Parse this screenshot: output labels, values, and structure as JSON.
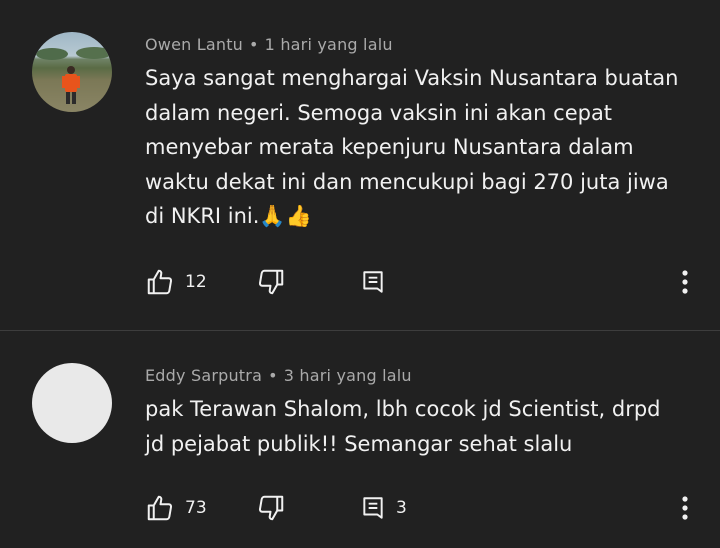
{
  "comments": [
    {
      "author": "Owen Lantu",
      "separator": "•",
      "time": "1 hari yang lalu",
      "text": "Saya sangat menghargai Vaksin Nusantara buatan\ndalam negeri. Semoga vaksin ini akan cepat\nmenyebar merata kepenjuru Nusantara dalam\nwaktu dekat ini dan mencukupi bagi 270 juta jiwa\ndi NKRI ini.🙏👍",
      "likes": "12",
      "replies": ""
    },
    {
      "author": "Eddy Sarputra",
      "separator": "•",
      "time": "3 hari yang lalu",
      "text": "pak Terawan Shalom, lbh cocok jd Scientist, drpd\njd pejabat publik!! Semangar sehat slalu",
      "likes": "73",
      "replies": "3"
    }
  ],
  "icons": {
    "like": "thumb-up-icon",
    "dislike": "thumb-down-icon",
    "reply": "reply-icon",
    "more": "more-vertical-icon"
  },
  "colors": {
    "background": "#212121",
    "meta_text": "#aaaaaa",
    "body_text": "#f1f1f1"
  }
}
